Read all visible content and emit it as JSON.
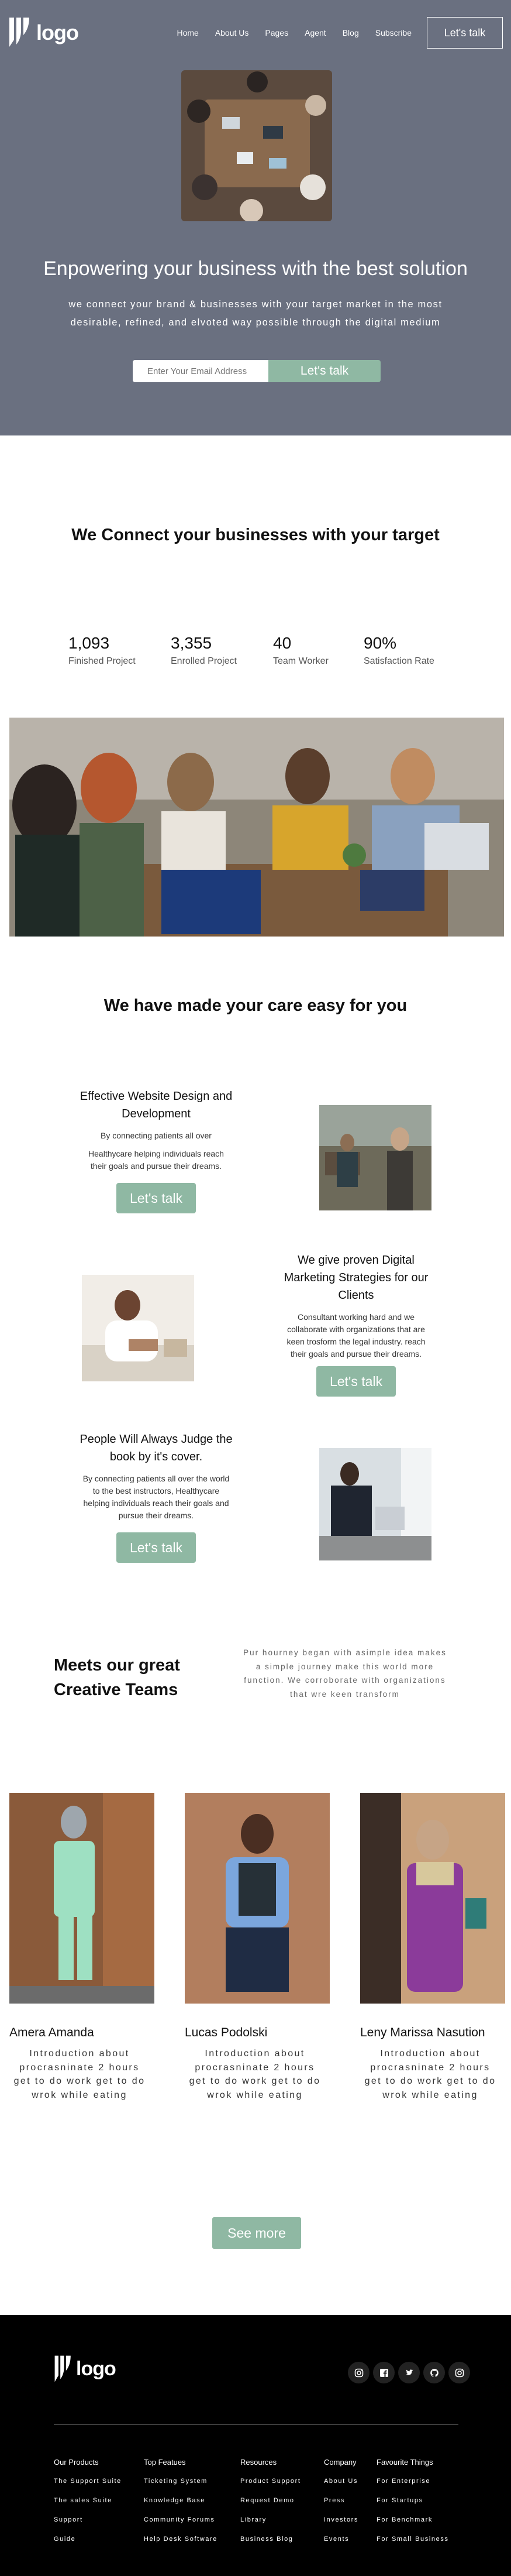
{
  "header": {
    "logo_text": "logo",
    "nav": [
      "Home",
      "About Us",
      "Pages",
      "Agent",
      "Blog",
      "Subscribe"
    ],
    "cta": "Let's talk"
  },
  "hero": {
    "title": "Enpowering your business with the best solution",
    "subtitle": "we connect your brand & businesses with your target market in the most desirable, refined, and elvoted way possible through the digital medium",
    "email_placeholder": "Enter Your Email Address",
    "submit": "Let's talk"
  },
  "connect": {
    "title": "We Connect your businesses with your target",
    "stats": [
      {
        "value": "1,093",
        "label": "Finished Project"
      },
      {
        "value": "3,355",
        "label": "Enrolled Project"
      },
      {
        "value": "40",
        "label": "Team Worker"
      },
      {
        "value": "90%",
        "label": "Satisfaction Rate"
      }
    ]
  },
  "care": {
    "title": "We have made your care easy for you",
    "features": [
      {
        "title": "Effective Website Design and Development",
        "text": "By connecting patients all over",
        "text2": "Healthycare helping individuals reach their goals and pursue their dreams.",
        "button": "Let's talk"
      },
      {
        "title": "We give proven Digital Marketing Strategies for our Clients",
        "text": "Consultant working hard and we collaborate with organizations that are keen trosform the legal industry. reach their goals and pursue their dreams.",
        "button": "Let's talk"
      },
      {
        "title": "People Will Always Judge the book by it's cover.",
        "text": "By connecting patients all over the world to the best instructors, Healthycare helping individuals reach their goals and pursue their dreams.",
        "button": "Let's talk"
      }
    ]
  },
  "team": {
    "title": "Meets our great Creative Teams",
    "description": "Pur hourney began with asimple idea makes a simple journey make this world more function. We corroborate with organizations that wre keen transform",
    "members": [
      {
        "name": "Amera Amanda",
        "bio": "Introduction about procrasninate 2 hours get to do work get to do wrok while eating"
      },
      {
        "name": "Lucas Podolski",
        "bio": "Introduction about procrasninate 2 hours get to do work get to do wrok while eating"
      },
      {
        "name": "Leny Marissa Nasution",
        "bio": "Introduction about procrasninate 2 hours get to do work get to do wrok while eating"
      }
    ],
    "see_more": "See more"
  },
  "footer": {
    "logo_text": "logo",
    "columns": [
      {
        "title": "Our Products",
        "links": [
          "The Support Suite",
          "The sales Suite",
          "Support",
          "Guide"
        ]
      },
      {
        "title": "Top Featues",
        "links": [
          "Ticketing System",
          "Knowledge Base",
          "Community Forums",
          "Help Desk Software"
        ]
      },
      {
        "title": "Resources",
        "links": [
          "Product Support",
          "Request Demo",
          "Library",
          "Business Blog"
        ]
      },
      {
        "title": "Company",
        "links": [
          "About Us",
          "Press",
          "Investors",
          "Events"
        ]
      },
      {
        "title": "Favourite Things",
        "links": [
          "For Enterprise",
          "For Startups",
          "For Benchmark",
          "For Small Business"
        ]
      }
    ],
    "socials": [
      "instagram-icon",
      "facebook-icon",
      "twitter-icon",
      "github-icon",
      "instagram-icon"
    ]
  },
  "colors": {
    "hero_bg": "#6a7080",
    "accent": "#8fb8a3",
    "footer_bg": "#000000"
  }
}
